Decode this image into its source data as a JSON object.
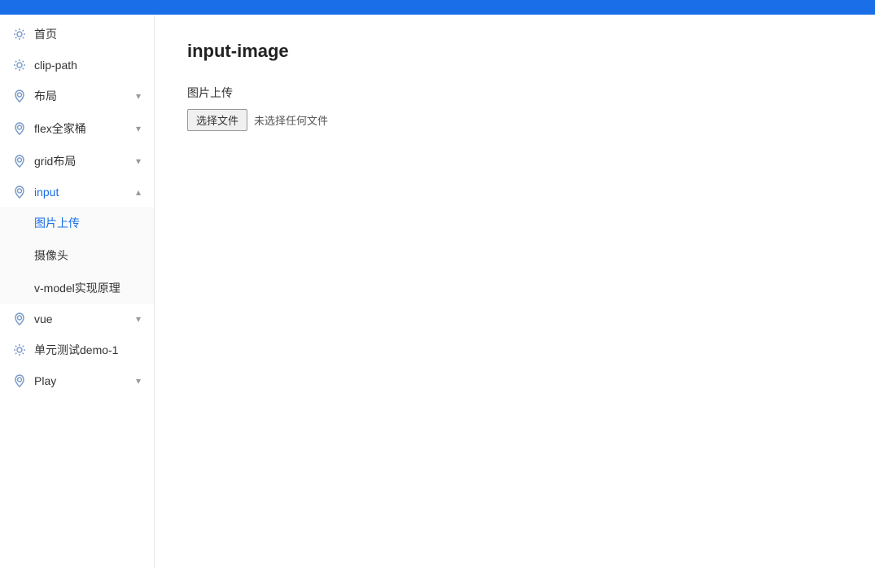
{
  "topbar": {
    "color": "#1a6fe8"
  },
  "sidebar": {
    "items": [
      {
        "id": "home",
        "label": "首页",
        "icon": "gear",
        "expanded": false,
        "hasChevron": false
      },
      {
        "id": "clip-path",
        "label": "clip-path",
        "icon": "gear",
        "expanded": false,
        "hasChevron": false
      },
      {
        "id": "layout",
        "label": "布局",
        "icon": "location",
        "expanded": false,
        "hasChevron": true,
        "chevron": "▾"
      },
      {
        "id": "flex",
        "label": "flex全家桶",
        "icon": "location",
        "expanded": false,
        "hasChevron": true,
        "chevron": "▾"
      },
      {
        "id": "grid",
        "label": "grid布局",
        "icon": "location",
        "expanded": false,
        "hasChevron": true,
        "chevron": "▾"
      },
      {
        "id": "input",
        "label": "input",
        "icon": "location",
        "expanded": true,
        "hasChevron": true,
        "chevron": "▴",
        "children": [
          {
            "id": "image-upload",
            "label": "图片上传",
            "active": true
          },
          {
            "id": "camera",
            "label": "摄像头",
            "active": false
          },
          {
            "id": "v-model",
            "label": "v-model实现原理",
            "active": false
          }
        ]
      },
      {
        "id": "vue",
        "label": "vue",
        "icon": "location",
        "expanded": false,
        "hasChevron": true,
        "chevron": "▾"
      },
      {
        "id": "unit-test",
        "label": "单元测试demo-1",
        "icon": "gear",
        "expanded": false,
        "hasChevron": false
      },
      {
        "id": "play",
        "label": "Play",
        "icon": "location",
        "expanded": false,
        "hasChevron": true,
        "chevron": "▾"
      }
    ]
  },
  "main": {
    "title": "input-image",
    "upload_label": "图片上传",
    "choose_button": "选择文件",
    "no_file_text": "未选择任何文件"
  }
}
